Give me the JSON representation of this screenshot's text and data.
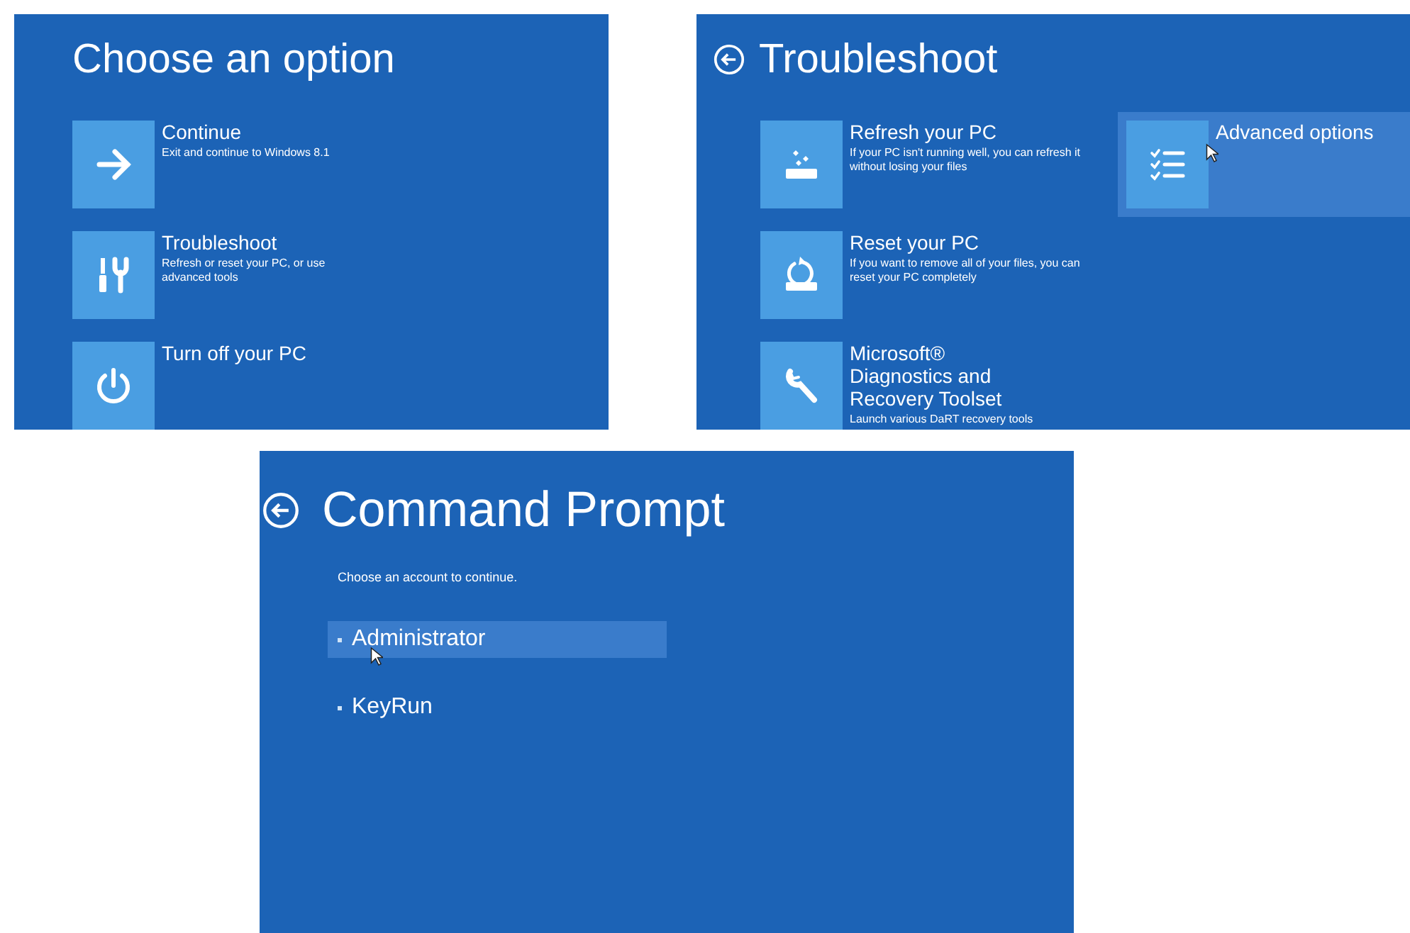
{
  "choose_option": {
    "title": "Choose an option",
    "tiles": [
      {
        "kind": "arrow",
        "title": "Continue",
        "description": "Exit and continue to Windows 8.1",
        "selected": false
      },
      {
        "kind": "tools",
        "title": "Troubleshoot",
        "description": "Refresh or reset your PC, or use advanced tools",
        "selected": false
      },
      {
        "kind": "power",
        "title": "Turn off your PC",
        "selected": false
      }
    ]
  },
  "troubleshoot": {
    "title": "Troubleshoot",
    "tiles": [
      {
        "kind": "refresh",
        "title": "Refresh your PC",
        "description": "If your PC isn't running well, you can refresh it without losing your files",
        "selected": false
      },
      {
        "kind": "reset",
        "title": "Reset your PC",
        "description": "If you want to remove all of your files, you can reset your PC completely",
        "selected": false
      },
      {
        "kind": "wrench",
        "title": "Microsoft® Diagnostics and Recovery Toolset",
        "description": "Launch various DaRT recovery tools",
        "selected": false
      },
      {
        "kind": "checklist",
        "title": "Advanced options",
        "selected": true
      }
    ]
  },
  "command_prompt": {
    "title": "Command Prompt",
    "instruction": "Choose an account to continue.",
    "accounts": [
      {
        "name": "Administrator",
        "selected": true
      },
      {
        "name": "KeyRun",
        "selected": false
      }
    ]
  }
}
